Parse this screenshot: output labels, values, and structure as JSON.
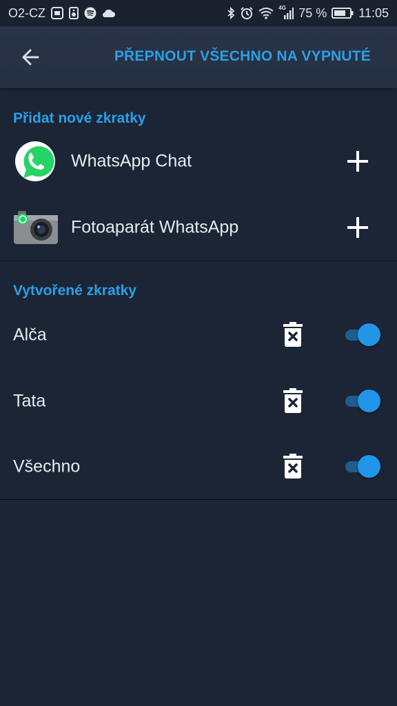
{
  "status_bar": {
    "carrier": "O2-CZ",
    "network_type": "4G",
    "battery": "75 %",
    "time": "11:05",
    "left_icons": [
      "gallery-icon",
      "speaker-icon",
      "spotify-icon",
      "cloud-icon"
    ],
    "right_icons": [
      "bluetooth-icon",
      "alarm-icon",
      "wifi-icon",
      "signal-icon",
      "battery-icon"
    ]
  },
  "toolbar": {
    "back_icon": "arrow-left-icon",
    "toggle_all_label": "PŘEPNOUT VŠECHNO NA VYPNUTÉ"
  },
  "add_section": {
    "title": "Přidat nové zkratky",
    "items": [
      {
        "label": "WhatsApp Chat",
        "icon": "whatsapp-icon"
      },
      {
        "label": "Fotoaparát WhatsApp",
        "icon": "whatsapp-camera-icon"
      }
    ]
  },
  "created_section": {
    "title": "Vytvořené zkratky",
    "items": [
      {
        "label": "Alča",
        "enabled": true
      },
      {
        "label": "Tata",
        "enabled": true
      },
      {
        "label": "Všechno",
        "enabled": true
      }
    ]
  },
  "colors": {
    "accent": "#2b9fe8",
    "background": "#1b2535",
    "toolbar": "#283244",
    "whatsapp_green": "#25d366"
  }
}
